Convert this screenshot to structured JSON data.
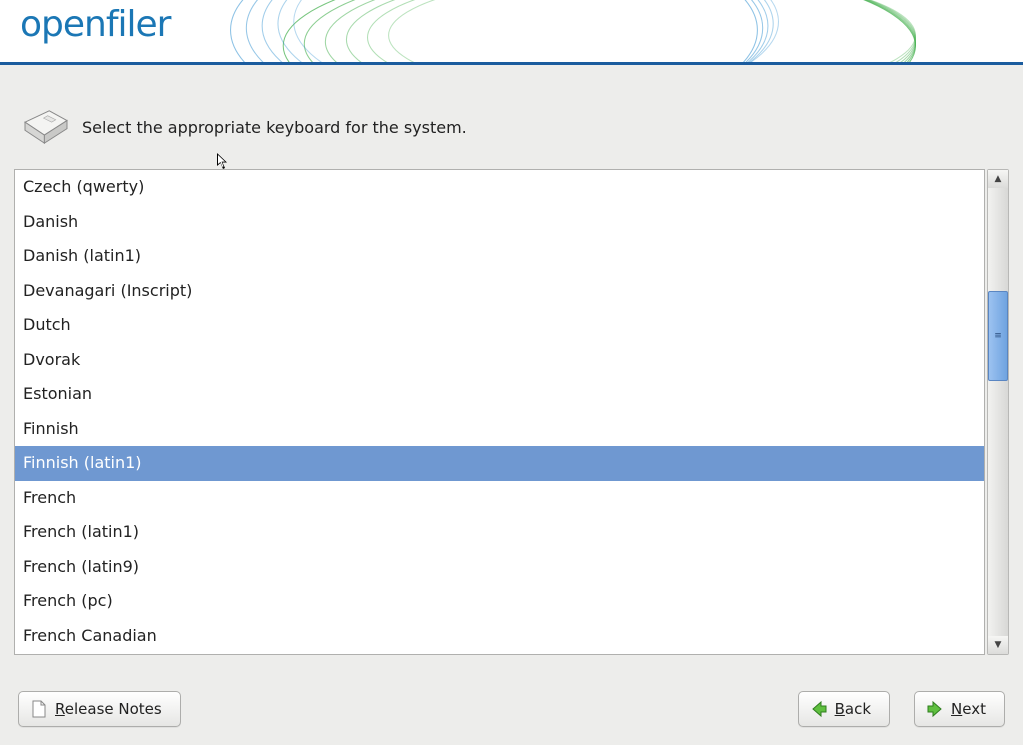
{
  "brand": "openfiler",
  "prompt": "Select the appropriate keyboard for the system.",
  "keyboard_list": {
    "selected_index": 8,
    "items": [
      "Czech (qwerty)",
      "Danish",
      "Danish (latin1)",
      "Devanagari (Inscript)",
      "Dutch",
      "Dvorak",
      "Estonian",
      "Finnish",
      "Finnish (latin1)",
      "French",
      "French (latin1)",
      "French (latin9)",
      "French (pc)",
      "French Canadian"
    ]
  },
  "scrollbar": {
    "thumb_top_pct": 23,
    "thumb_height_pct": 20
  },
  "buttons": {
    "release_notes": {
      "prefix": "",
      "ul": "R",
      "rest": "elease Notes"
    },
    "back": {
      "prefix": "",
      "ul": "B",
      "rest": "ack"
    },
    "next": {
      "prefix": "",
      "ul": "N",
      "rest": "ext"
    }
  },
  "colors": {
    "accent": "#1b77b5",
    "selection": "#6f98d1"
  }
}
